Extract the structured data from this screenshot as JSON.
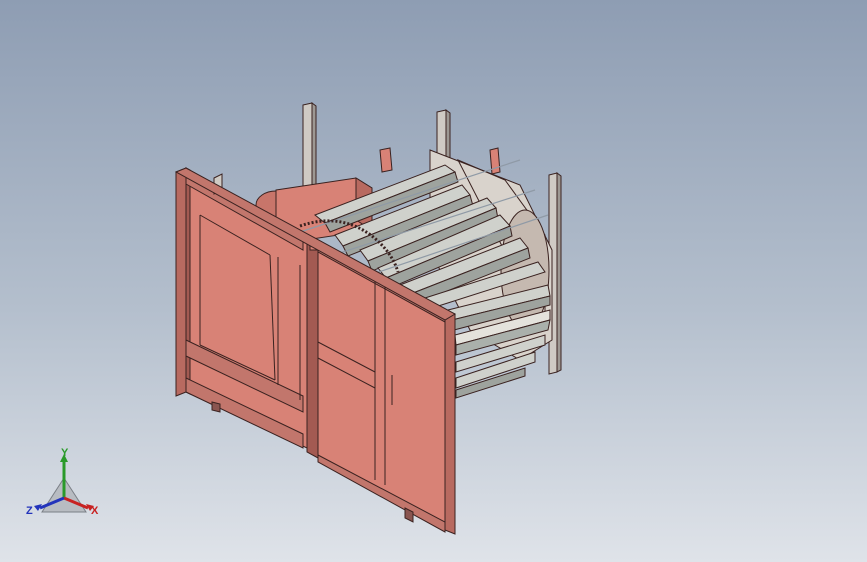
{
  "viewport": {
    "background_top": "#8e9db3",
    "background_bottom": "#dfe3e9"
  },
  "model": {
    "body_color": "#d88276",
    "edge_color": "#3a2220",
    "blade_color": "#c9cbc6",
    "shaft_color": "#8f9aa6"
  },
  "triad": {
    "x_label": "X",
    "y_label": "Y",
    "z_label": "Z",
    "x_color": "#c82222",
    "y_color": "#2a9a2a",
    "z_color": "#2233bb"
  }
}
